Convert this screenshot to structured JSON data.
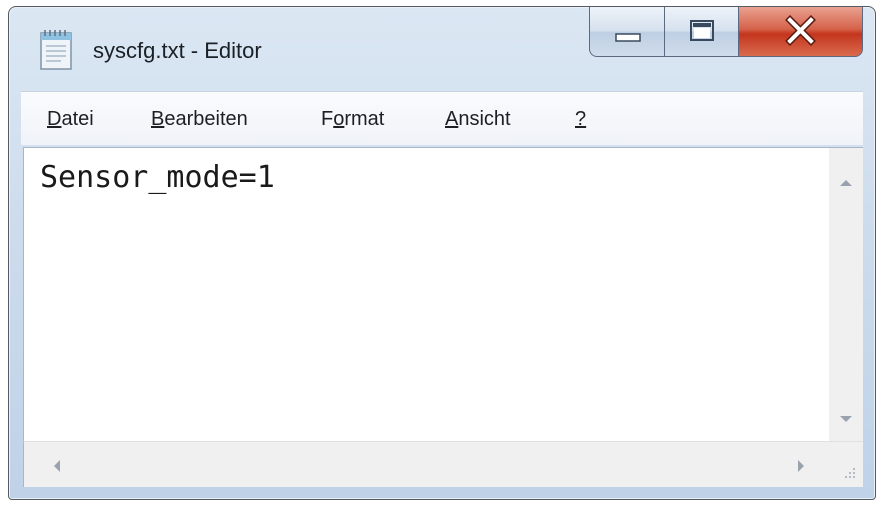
{
  "window": {
    "title": "syscfg.txt - Editor"
  },
  "caption_buttons": {
    "minimize_icon": "minimize-icon",
    "maximize_icon": "maximize-icon",
    "close_icon": "close-icon",
    "close_color": "#c9442a"
  },
  "menu": {
    "items": [
      {
        "accel": "D",
        "rest": "atei"
      },
      {
        "accel": "B",
        "rest": "earbeiten"
      },
      {
        "pre": "F",
        "accel": "o",
        "rest": "rmat"
      },
      {
        "accel": "A",
        "rest": "nsicht"
      },
      {
        "accel": "?",
        "rest": ""
      }
    ]
  },
  "editor": {
    "content": "Sensor_mode=1"
  },
  "icons": {
    "app": "notepad-icon",
    "scroll_up": "scroll-up-arrow-icon",
    "scroll_down": "scroll-down-arrow-icon",
    "scroll_left": "scroll-left-arrow-icon",
    "scroll_right": "scroll-right-arrow-icon",
    "size_grip": "size-grip-icon"
  }
}
